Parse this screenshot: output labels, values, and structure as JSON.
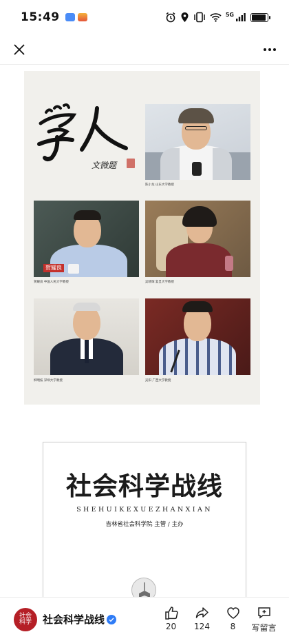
{
  "status_bar": {
    "time": "15:49",
    "network": "5G",
    "battery_level": 0.9,
    "icons": [
      "app-notification-icon",
      "alarm-icon",
      "location-icon",
      "vibrate-icon",
      "wifi-icon",
      "signal-icon",
      "battery-icon"
    ]
  },
  "nav": {
    "close_icon": "close-icon",
    "more_icon": "more-icon"
  },
  "poster": {
    "calligraphy_text": "学人",
    "signature": "文微题",
    "nameplate": "贺耀良",
    "captions": [
      "陈小龙  山东大学教授",
      "贺耀良  中国人民大学教授",
      "吴晓辉  复旦大学教授",
      "柳明枝  深圳大学教授",
      "吴阳  广西大学教授"
    ]
  },
  "cover": {
    "title": "社会科学战线",
    "pinyin": "SHEHUIKEXUEZHANXIAN",
    "publisher": "吉林省社会科学院  主管 / 主办"
  },
  "bottom_bar": {
    "account_name": "社会科学战线",
    "avatar_text": "社会科学",
    "actions": [
      {
        "icon": "thumbs-up-icon",
        "label": "20"
      },
      {
        "icon": "share-icon",
        "label": "124"
      },
      {
        "icon": "heart-icon",
        "label": "8"
      },
      {
        "icon": "comment-add-icon",
        "label": "写留言"
      }
    ]
  },
  "colors": {
    "poster_bg": "#f1f0ec",
    "avatar_red": "#b51f26",
    "verified_blue": "#2f7cf6"
  }
}
